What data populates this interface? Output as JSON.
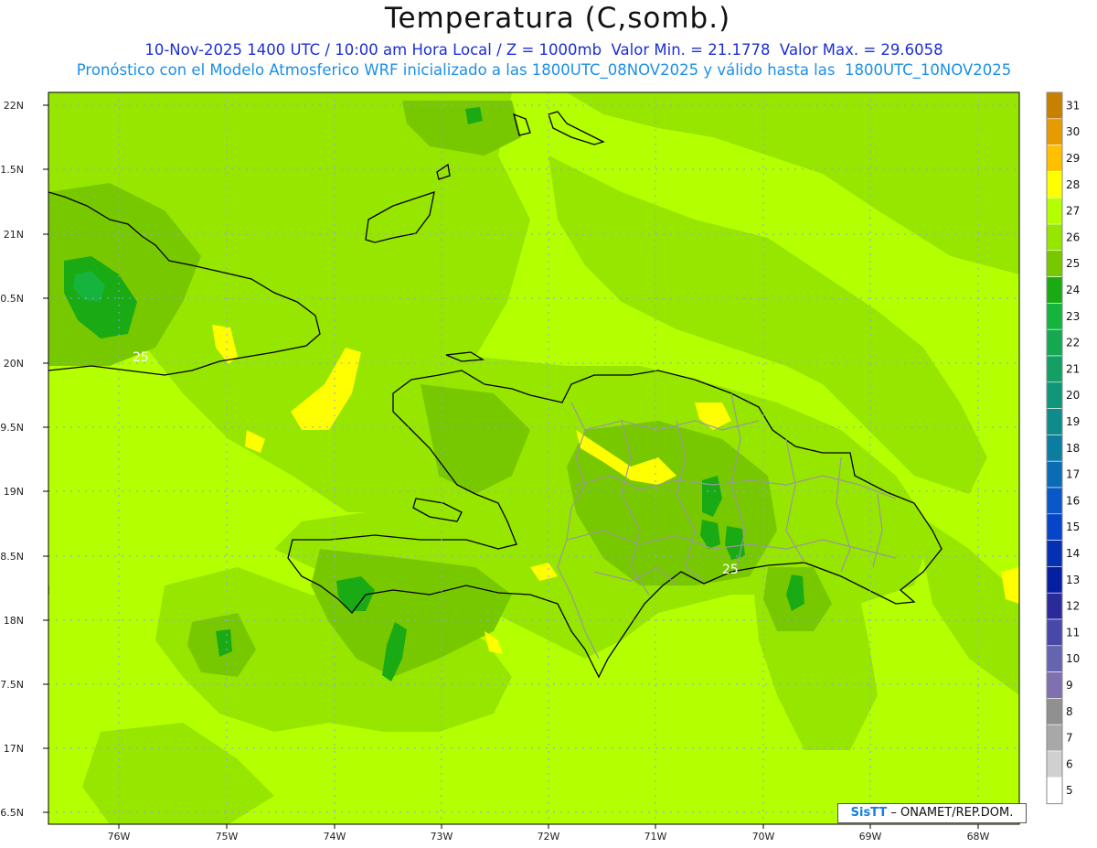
{
  "header": {
    "title": "Temperatura (C,somb.)",
    "line1": "10-Nov-2025 1400 UTC / 10:00 am Hora Local / Z = 1000mb  Valor Min. = 21.1778  Valor Max. = 29.6058",
    "line2": "Pronóstico con el Modelo Atmosferico WRF inicializado a las 1800UTC_08NOV2025 y válido hasta las  1800UTC_10NOV2025"
  },
  "axes": {
    "lat_labels": [
      "22N",
      "21.5N",
      "21N",
      "20.5N",
      "20N",
      "19.5N",
      "19N",
      "18.5N",
      "18N",
      "17.5N",
      "17N",
      "16.5N"
    ],
    "lon_labels": [
      "76W",
      "75W",
      "74W",
      "73W",
      "72W",
      "71W",
      "70W",
      "69W",
      "68W"
    ]
  },
  "colorbar": {
    "labels": [
      "31",
      "30",
      "29",
      "28",
      "27",
      "26",
      "25",
      "24",
      "23",
      "22",
      "21",
      "20",
      "19",
      "18",
      "17",
      "16",
      "15",
      "14",
      "13",
      "12",
      "11",
      "10",
      "9",
      "8",
      "7",
      "6",
      "5"
    ],
    "colors": [
      "#c78000",
      "#e69b00",
      "#ffc000",
      "#ffff00",
      "#b4ff00",
      "#96e600",
      "#78c800",
      "#1aaa14",
      "#16b43c",
      "#14a850",
      "#12a064",
      "#109678",
      "#0e8c8c",
      "#0c7ca0",
      "#0a6cb4",
      "#0858c8",
      "#0644c8",
      "#0430b4",
      "#0420a0",
      "#2a2a9a",
      "#4848a8",
      "#6464b0",
      "#8070b0",
      "#909090",
      "#a8a8a8",
      "#d0d0d0",
      "#ffffff"
    ]
  },
  "contour_labels": [
    "25",
    "25"
  ],
  "map_colors": {
    "t28": "#ffff00",
    "t27": "#b4ff00",
    "t26": "#96e600",
    "t25": "#78c800",
    "t24": "#1aaa14",
    "t23": "#16b43c",
    "coast": "#000000",
    "border": "#999999",
    "grid": "#9999ff"
  },
  "credit": {
    "logo": "SisTT",
    "text": " – ONAMET/REP.DOM."
  }
}
